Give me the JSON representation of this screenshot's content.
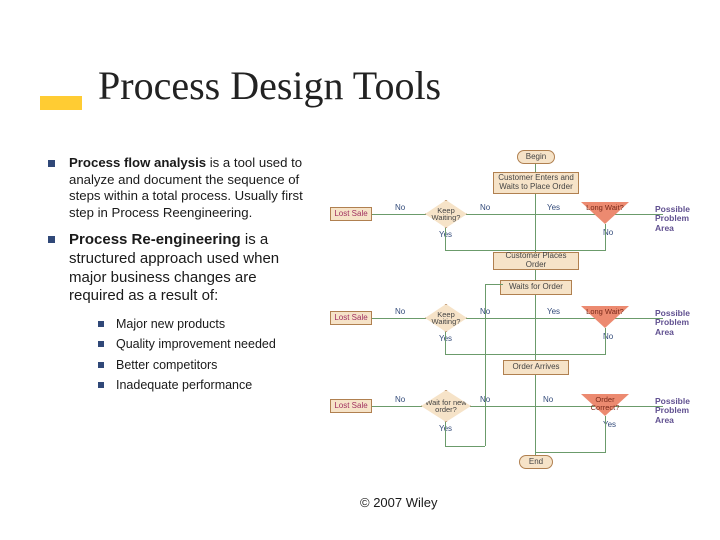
{
  "title": "Process Design Tools",
  "bullets": [
    {
      "bold": "Process flow analysis",
      "rest": " is a tool used to analyze and document the sequence of steps within a total process. Usually first step in Process Reengineering."
    },
    {
      "bold": "Process Re-engineering",
      "rest": " is a structured approach used when major business changes are required as a result of:"
    }
  ],
  "sublist": [
    "Major new products",
    "Quality improvement needed",
    "Better competitors",
    "Inadequate performance"
  ],
  "copyright": "© 2007 Wiley",
  "flow": {
    "begin": "Begin",
    "end": "End",
    "customerEnters": "Customer Enters and Waits to Place Order",
    "customerPlaces": "Customer Places Order",
    "waitsOrder": "Waits for Order",
    "orderArrives": "Order Arrives",
    "keepWaiting1": "Keep Waiting?",
    "keepWaiting2": "Keep Waiting?",
    "waitNewOrder": "Wait for new order?",
    "longWait1": "Long Wait?",
    "longWait2": "Long Wait?",
    "orderCorrect": "Order Correct?",
    "lostSale": "Lost Sale",
    "problemArea": "Possible Problem Area",
    "yes": "Yes",
    "no": "No"
  }
}
